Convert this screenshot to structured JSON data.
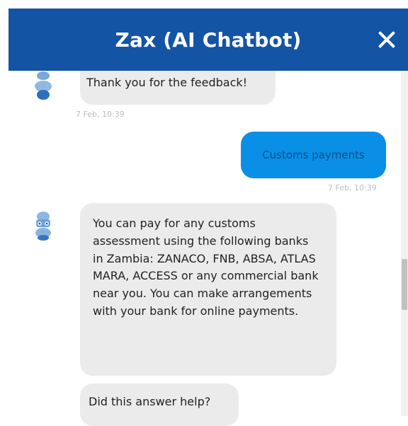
{
  "header": {
    "title": "Zax (AI Chatbot)"
  },
  "messages": [
    {
      "sender": "bot",
      "text": "Thank you for the feedback!",
      "time": "7 Feb, 10:39"
    },
    {
      "sender": "user",
      "text": "Customs payments",
      "time": "7 Feb, 10:39"
    },
    {
      "sender": "bot",
      "text": "You can pay for any customs assessment using the following banks in Zambia: ZANACO, FNB, ABSA, ATLAS MARA, ACCESS or any commercial bank near you. You can make arrangements with your bank for online payments."
    },
    {
      "sender": "bot",
      "text": "Did this answer help?"
    }
  ],
  "colors": {
    "header": "#1454a4",
    "user_bubble": "#0a8fe6",
    "bot_bubble": "#ebebeb"
  },
  "icons": [
    "close-icon",
    "robot-avatar-icon"
  ]
}
